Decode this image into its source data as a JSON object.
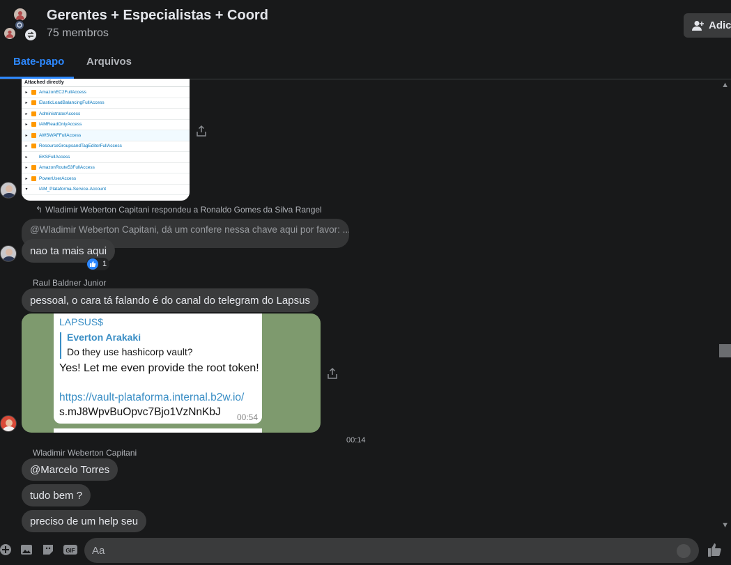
{
  "header": {
    "title": "Gerentes + Especialistas + Coord",
    "members": "75 membros",
    "add_button": "Adici"
  },
  "tabs": [
    {
      "label": "Bate-papo",
      "active": true
    },
    {
      "label": "Arquivos",
      "active": false
    }
  ],
  "aws_policies": {
    "heading": "Attached directly",
    "rows": [
      "AmazonEC2FullAccess",
      "ElasticLoadBalancingFullAccess",
      "AdministratorAccess",
      "IAMReadOnlyAccess",
      "AWSWAFFullAccess",
      "ResourceGroupsandTagEditorFullAccess",
      "EKSFullAccess",
      "AmazonRoute53FullAccess",
      "PowerUserAccess",
      "IAM_Plataforma-Service-Account"
    ]
  },
  "messages": {
    "reply_info": "Wladimir Weberton Capitani respondeu a Ronaldo Gomes da Silva Rangel",
    "quoted_text": "@Wladimir Weberton Capitani, dá um confere nessa chave aqui por favor: ...",
    "reply_text": "nao ta mais aqui",
    "reaction_count": "1",
    "raul_name": "Raul Baldner Junior",
    "raul_text": "pessoal, o cara tá falando é do canal do telegram do Lapsus",
    "timestamp": "00:14",
    "wladimir_name": "Wladimir Weberton Capitani",
    "msg1": "@Marcelo Torres",
    "msg2": "tudo bem ?",
    "msg3": "preciso de um help seu"
  },
  "telegram": {
    "channel": "LAPSUS$",
    "quote_name": "Everton Arakaki",
    "quote_text": "Do they use hashicorp vault?",
    "message": "Yes! Let me even provide the root token!",
    "link": "https://vault-plataforma.internal.b2w.io/",
    "token": "s.mJ8WpvBuOpvc7Bjo1VzNnKbJ",
    "time": "00:54"
  },
  "composer": {
    "placeholder": "Aa"
  },
  "colors": {
    "accent": "#2d88ff",
    "bubble": "#3a3b3c",
    "background": "#18191a"
  }
}
